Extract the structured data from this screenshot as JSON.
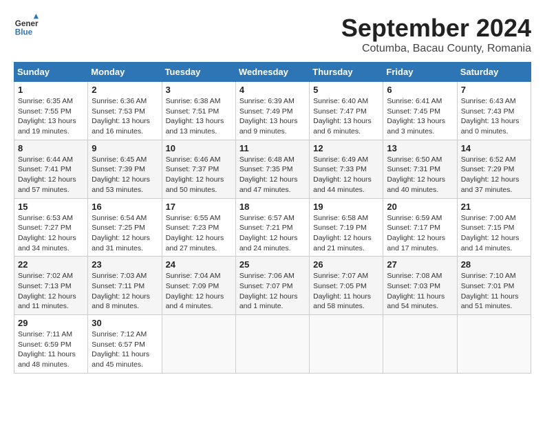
{
  "header": {
    "logo_line1": "General",
    "logo_line2": "Blue",
    "month": "September 2024",
    "location": "Cotumba, Bacau County, Romania"
  },
  "weekdays": [
    "Sunday",
    "Monday",
    "Tuesday",
    "Wednesday",
    "Thursday",
    "Friday",
    "Saturday"
  ],
  "weeks": [
    [
      {
        "day": "1",
        "info": "Sunrise: 6:35 AM\nSunset: 7:55 PM\nDaylight: 13 hours\nand 19 minutes."
      },
      {
        "day": "2",
        "info": "Sunrise: 6:36 AM\nSunset: 7:53 PM\nDaylight: 13 hours\nand 16 minutes."
      },
      {
        "day": "3",
        "info": "Sunrise: 6:38 AM\nSunset: 7:51 PM\nDaylight: 13 hours\nand 13 minutes."
      },
      {
        "day": "4",
        "info": "Sunrise: 6:39 AM\nSunset: 7:49 PM\nDaylight: 13 hours\nand 9 minutes."
      },
      {
        "day": "5",
        "info": "Sunrise: 6:40 AM\nSunset: 7:47 PM\nDaylight: 13 hours\nand 6 minutes."
      },
      {
        "day": "6",
        "info": "Sunrise: 6:41 AM\nSunset: 7:45 PM\nDaylight: 13 hours\nand 3 minutes."
      },
      {
        "day": "7",
        "info": "Sunrise: 6:43 AM\nSunset: 7:43 PM\nDaylight: 13 hours\nand 0 minutes."
      }
    ],
    [
      {
        "day": "8",
        "info": "Sunrise: 6:44 AM\nSunset: 7:41 PM\nDaylight: 12 hours\nand 57 minutes."
      },
      {
        "day": "9",
        "info": "Sunrise: 6:45 AM\nSunset: 7:39 PM\nDaylight: 12 hours\nand 53 minutes."
      },
      {
        "day": "10",
        "info": "Sunrise: 6:46 AM\nSunset: 7:37 PM\nDaylight: 12 hours\nand 50 minutes."
      },
      {
        "day": "11",
        "info": "Sunrise: 6:48 AM\nSunset: 7:35 PM\nDaylight: 12 hours\nand 47 minutes."
      },
      {
        "day": "12",
        "info": "Sunrise: 6:49 AM\nSunset: 7:33 PM\nDaylight: 12 hours\nand 44 minutes."
      },
      {
        "day": "13",
        "info": "Sunrise: 6:50 AM\nSunset: 7:31 PM\nDaylight: 12 hours\nand 40 minutes."
      },
      {
        "day": "14",
        "info": "Sunrise: 6:52 AM\nSunset: 7:29 PM\nDaylight: 12 hours\nand 37 minutes."
      }
    ],
    [
      {
        "day": "15",
        "info": "Sunrise: 6:53 AM\nSunset: 7:27 PM\nDaylight: 12 hours\nand 34 minutes."
      },
      {
        "day": "16",
        "info": "Sunrise: 6:54 AM\nSunset: 7:25 PM\nDaylight: 12 hours\nand 31 minutes."
      },
      {
        "day": "17",
        "info": "Sunrise: 6:55 AM\nSunset: 7:23 PM\nDaylight: 12 hours\nand 27 minutes."
      },
      {
        "day": "18",
        "info": "Sunrise: 6:57 AM\nSunset: 7:21 PM\nDaylight: 12 hours\nand 24 minutes."
      },
      {
        "day": "19",
        "info": "Sunrise: 6:58 AM\nSunset: 7:19 PM\nDaylight: 12 hours\nand 21 minutes."
      },
      {
        "day": "20",
        "info": "Sunrise: 6:59 AM\nSunset: 7:17 PM\nDaylight: 12 hours\nand 17 minutes."
      },
      {
        "day": "21",
        "info": "Sunrise: 7:00 AM\nSunset: 7:15 PM\nDaylight: 12 hours\nand 14 minutes."
      }
    ],
    [
      {
        "day": "22",
        "info": "Sunrise: 7:02 AM\nSunset: 7:13 PM\nDaylight: 12 hours\nand 11 minutes."
      },
      {
        "day": "23",
        "info": "Sunrise: 7:03 AM\nSunset: 7:11 PM\nDaylight: 12 hours\nand 8 minutes."
      },
      {
        "day": "24",
        "info": "Sunrise: 7:04 AM\nSunset: 7:09 PM\nDaylight: 12 hours\nand 4 minutes."
      },
      {
        "day": "25",
        "info": "Sunrise: 7:06 AM\nSunset: 7:07 PM\nDaylight: 12 hours\nand 1 minute."
      },
      {
        "day": "26",
        "info": "Sunrise: 7:07 AM\nSunset: 7:05 PM\nDaylight: 11 hours\nand 58 minutes."
      },
      {
        "day": "27",
        "info": "Sunrise: 7:08 AM\nSunset: 7:03 PM\nDaylight: 11 hours\nand 54 minutes."
      },
      {
        "day": "28",
        "info": "Sunrise: 7:10 AM\nSunset: 7:01 PM\nDaylight: 11 hours\nand 51 minutes."
      }
    ],
    [
      {
        "day": "29",
        "info": "Sunrise: 7:11 AM\nSunset: 6:59 PM\nDaylight: 11 hours\nand 48 minutes."
      },
      {
        "day": "30",
        "info": "Sunrise: 7:12 AM\nSunset: 6:57 PM\nDaylight: 11 hours\nand 45 minutes."
      },
      {
        "day": "",
        "info": ""
      },
      {
        "day": "",
        "info": ""
      },
      {
        "day": "",
        "info": ""
      },
      {
        "day": "",
        "info": ""
      },
      {
        "day": "",
        "info": ""
      }
    ]
  ]
}
